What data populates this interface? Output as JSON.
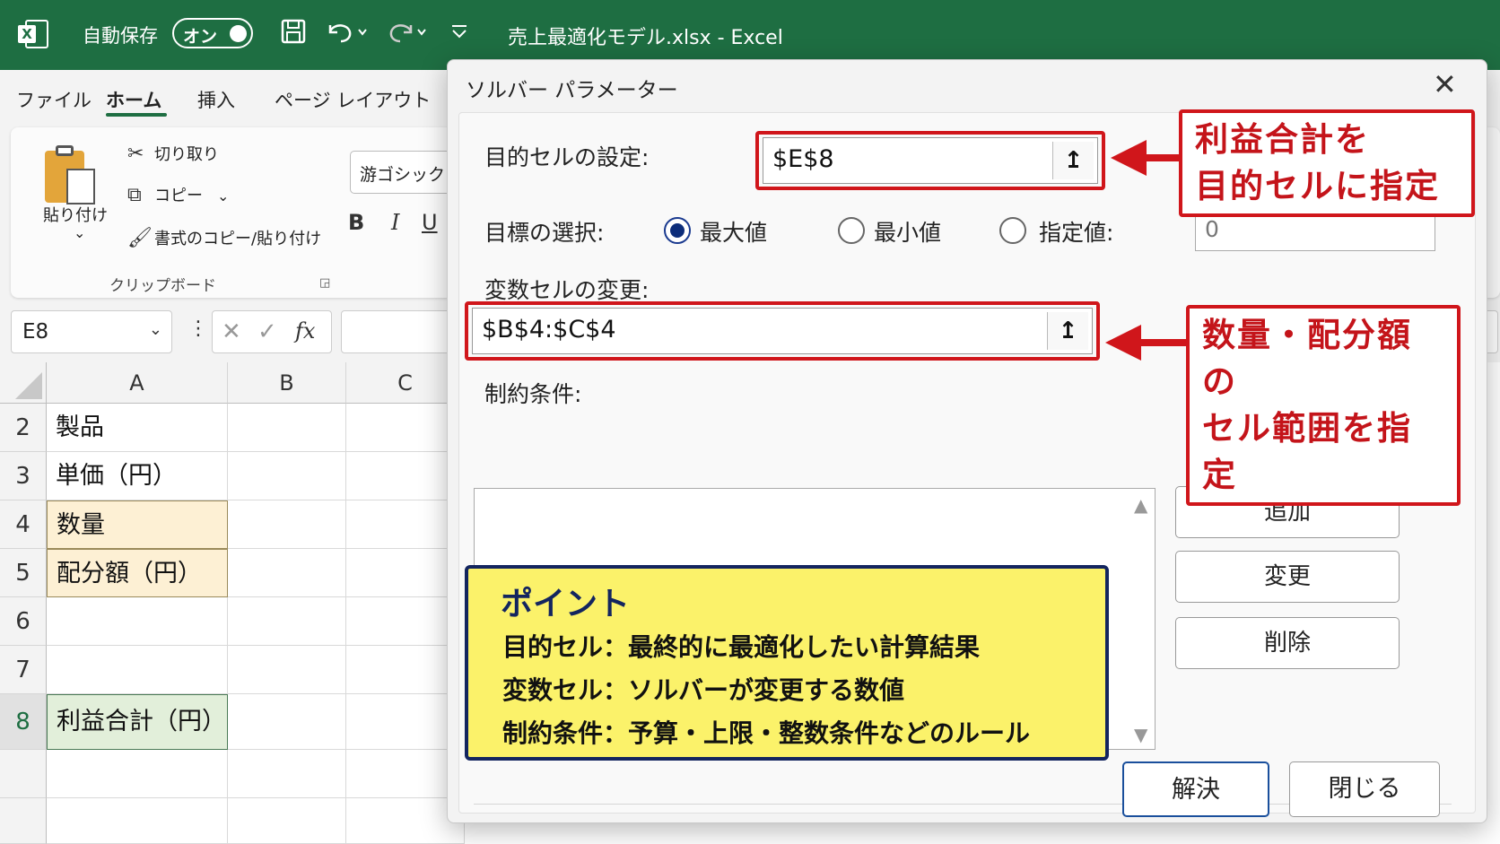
{
  "titlebar": {
    "autosave_label": "自動保存",
    "autosave_state": "オン",
    "doc_title": "売上最適化モデル.xlsx  -  Excel",
    "accent_color": "#1e6e42"
  },
  "ribbon": {
    "tabs": [
      {
        "label": "ファイル"
      },
      {
        "label": "ホーム"
      },
      {
        "label": "挿入"
      },
      {
        "label": "ページ レイアウト"
      }
    ],
    "active_tab": "ホーム",
    "paste_label": "貼り付け",
    "cut_label": "切り取り",
    "copy_label": "コピー",
    "format_painter_label": "書式のコピー/貼り付け",
    "clipboard_group_label": "クリップボード",
    "font_name": "游ゴシック",
    "bold": "B",
    "italic": "I",
    "underline": "U"
  },
  "formula_bar": {
    "name_box": "E8",
    "fx": "fx",
    "value": ""
  },
  "grid": {
    "columns": [
      "A",
      "B",
      "C"
    ],
    "rows": [
      {
        "num": "2",
        "a": "製品"
      },
      {
        "num": "3",
        "a": "単価（円）"
      },
      {
        "num": "4",
        "a": "数量"
      },
      {
        "num": "5",
        "a": "配分額（円）"
      },
      {
        "num": "6",
        "a": ""
      },
      {
        "num": "7",
        "a": ""
      },
      {
        "num": "8",
        "a": "利益合計（円）"
      }
    ]
  },
  "dialog": {
    "title": "ソルバー パラメーター",
    "objective_label": "目的セルの設定:",
    "objective_value": "$E$8",
    "goal_label": "目標の選択:",
    "options": [
      {
        "label": "最大値",
        "selected": true
      },
      {
        "label": "最小値",
        "selected": false
      },
      {
        "label": "指定値:",
        "selected": false
      }
    ],
    "target_value": "0",
    "variable_label": "変数セルの変更:",
    "variable_value": "$B$4:$C$4",
    "constraints_label": "制約条件:",
    "add_button": "追加",
    "change_button": "変更",
    "delete_button": "削除",
    "solve_button": "解決",
    "close_button": "閉じる"
  },
  "callouts": {
    "objective_note": [
      "利益合計を",
      "目的セルに指定"
    ],
    "variable_note": [
      "数量・配分額の",
      "セル範囲を指定"
    ],
    "point": {
      "title": "ポイント",
      "lines": [
        "目的セル：最終的に最適化したい計算結果",
        "変数セル：ソルバーが変更する数値",
        "制約条件：予算・上限・整数条件などのルール"
      ]
    },
    "highlight_color": "#d0161b",
    "point_bg": "#fbf26a",
    "point_border": "#13255f"
  }
}
